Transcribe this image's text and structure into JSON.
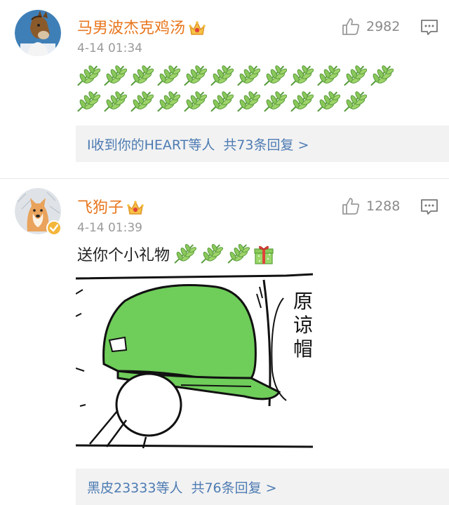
{
  "comments": [
    {
      "username": "马男波杰克鸡汤",
      "timestamp": "4-14 01:34",
      "likes": "2982",
      "leaf_rows": [
        12,
        11
      ],
      "reply_summary": {
        "users": "I收到你的HEART等人",
        "count_text": "共73条回复 >"
      }
    },
    {
      "username": "飞狗子",
      "timestamp": "4-14 01:39",
      "likes": "1288",
      "text": "送你个小礼物",
      "meme_text": "原谅帽",
      "reply_summary": {
        "users": "黑皮23333等人",
        "count_text": "共76条回复 >"
      }
    }
  ],
  "colors": {
    "username": "#e8771f",
    "link": "#4d7bb3",
    "meta": "#9a9a9a",
    "hat_green": "#6fcd5a"
  }
}
